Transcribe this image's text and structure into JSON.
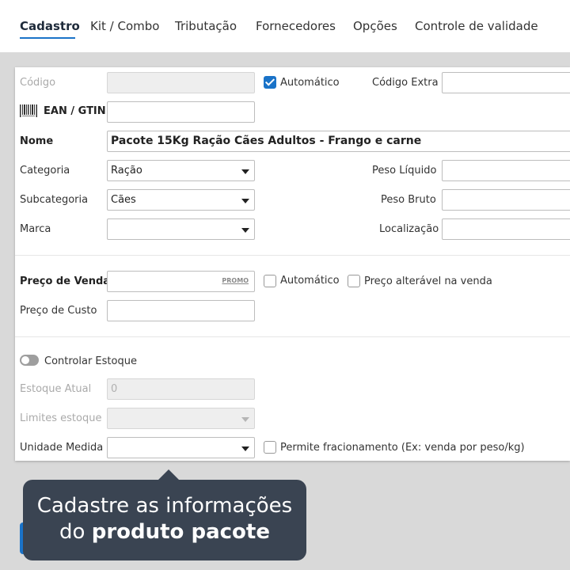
{
  "tabs": [
    {
      "label": "Cadastro",
      "active": true
    },
    {
      "label": "Kit / Combo",
      "active": false
    },
    {
      "label": "Tributação",
      "active": false
    },
    {
      "label": "Fornecedores",
      "active": false
    },
    {
      "label": "Opções",
      "active": false
    },
    {
      "label": "Controle de validade",
      "active": false
    }
  ],
  "form": {
    "codigo": {
      "label": "Código",
      "value": ""
    },
    "automatico_codigo": {
      "label": "Automático",
      "checked": true
    },
    "codigo_extra": {
      "label": "Código Extra",
      "value": ""
    },
    "ean": {
      "label": "EAN / GTIN",
      "icon": "barcode-icon",
      "value": ""
    },
    "nome": {
      "label": "Nome",
      "value": "Pacote 15Kg Ração Cães Adultos - Frango e carne"
    },
    "categoria": {
      "label": "Categoria",
      "value": "Ração"
    },
    "subcategoria": {
      "label": "Subcategoria",
      "value": "Cães"
    },
    "marca": {
      "label": "Marca",
      "value": ""
    },
    "peso_liquido": {
      "label": "Peso Líquido",
      "value": ""
    },
    "peso_bruto": {
      "label": "Peso Bruto",
      "value": ""
    },
    "localizacao": {
      "label": "Localização",
      "value": ""
    },
    "preco_venda": {
      "label": "Preço de Venda",
      "value": "",
      "promo": "PROMO"
    },
    "automatico_preco": {
      "label": "Automático",
      "checked": false
    },
    "preco_alteravel": {
      "label": "Preço alterável na venda",
      "checked": false
    },
    "preco_custo": {
      "label": "Preço de Custo",
      "value": ""
    },
    "controlar_estoque": {
      "label": "Controlar Estoque",
      "enabled": false
    },
    "estoque_atual": {
      "label": "Estoque Atual",
      "value": "0"
    },
    "limites_estoque": {
      "label": "Limites estoque",
      "value": ""
    },
    "unidade_medida": {
      "label": "Unidade Medida",
      "value": ""
    },
    "fracionamento": {
      "label": "Permite fracionamento (Ex: venda por peso/kg)",
      "checked": false
    }
  },
  "tooltip": {
    "line1": "Cadastre as informações",
    "line2_prefix": "do ",
    "line2_bold": "produto pacote"
  },
  "colors": {
    "accent": "#1a73c8",
    "tooltip_bg": "#3a4452",
    "background": "#d9d9d9"
  }
}
